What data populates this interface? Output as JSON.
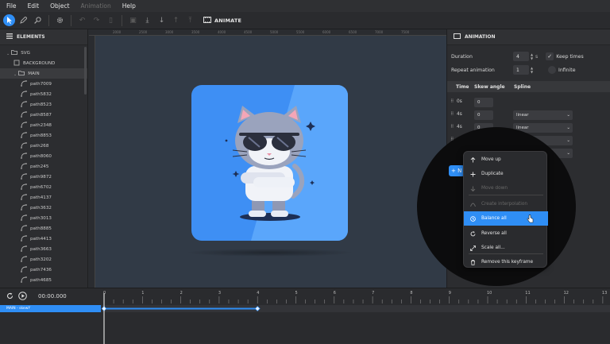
{
  "menu": {
    "items": [
      {
        "label": "File",
        "disabled": false
      },
      {
        "label": "Edit",
        "disabled": false
      },
      {
        "label": "Object",
        "disabled": false
      },
      {
        "label": "Animation",
        "disabled": true
      },
      {
        "label": "Help",
        "disabled": false
      }
    ]
  },
  "toolbar": {
    "animate_label": "ANIMATE"
  },
  "elements": {
    "title": "ELEMENTS",
    "tree": [
      {
        "label": "SVG",
        "level": 0,
        "kind": "folder"
      },
      {
        "label": "BACKGROUND",
        "level": 1,
        "kind": "item"
      },
      {
        "label": "MAIN",
        "level": 1,
        "kind": "folder",
        "selected": true
      },
      {
        "label": "path7009",
        "level": 2,
        "kind": "path"
      },
      {
        "label": "path5832",
        "level": 2,
        "kind": "path"
      },
      {
        "label": "path8523",
        "level": 2,
        "kind": "path"
      },
      {
        "label": "path8587",
        "level": 2,
        "kind": "path"
      },
      {
        "label": "path2348",
        "level": 2,
        "kind": "path"
      },
      {
        "label": "path8853",
        "level": 2,
        "kind": "path"
      },
      {
        "label": "path268",
        "level": 2,
        "kind": "path"
      },
      {
        "label": "path8060",
        "level": 2,
        "kind": "path"
      },
      {
        "label": "path245",
        "level": 2,
        "kind": "path"
      },
      {
        "label": "path9872",
        "level": 2,
        "kind": "path"
      },
      {
        "label": "path6702",
        "level": 2,
        "kind": "path"
      },
      {
        "label": "path4137",
        "level": 2,
        "kind": "path"
      },
      {
        "label": "path3632",
        "level": 2,
        "kind": "path"
      },
      {
        "label": "path3013",
        "level": 2,
        "kind": "path"
      },
      {
        "label": "path8885",
        "level": 2,
        "kind": "path"
      },
      {
        "label": "path4413",
        "level": 2,
        "kind": "path"
      },
      {
        "label": "path3663",
        "level": 2,
        "kind": "path"
      },
      {
        "label": "path3202",
        "level": 2,
        "kind": "path"
      },
      {
        "label": "path7436",
        "level": 2,
        "kind": "path"
      },
      {
        "label": "path4685",
        "level": 2,
        "kind": "path"
      }
    ]
  },
  "ruler": {
    "labels": [
      "2000",
      "2500",
      "3000",
      "3500",
      "4000",
      "4500",
      "5000",
      "5500",
      "6000",
      "6500",
      "7000",
      "7500"
    ]
  },
  "animation": {
    "title": "ANIMATION",
    "duration_label": "Duration",
    "duration_value": "4",
    "duration_unit": "s",
    "keep_times_label": "Keep times",
    "repeat_label": "Repeat animation",
    "repeat_value": "1",
    "infinite_label": "Infinite",
    "col_time": "Time",
    "col_skew": "Skew angle",
    "col_spline": "Spline",
    "keyframes": [
      {
        "time": "0s",
        "skew": "0",
        "spline": ""
      },
      {
        "time": "4s",
        "skew": "0",
        "spline": "linear"
      },
      {
        "time": "4s",
        "skew": "0",
        "spline": "linear"
      },
      {
        "time": "4s",
        "skew": "0",
        "spline": "linear"
      },
      {
        "time": "4s",
        "skew": "0",
        "spline": "linear"
      }
    ],
    "add_label": "+ N"
  },
  "context_menu": {
    "items": [
      {
        "label": "Move up",
        "icon": "arrow-up-icon",
        "disabled": false
      },
      {
        "label": "Duplicate",
        "icon": "plus-icon",
        "disabled": false
      },
      {
        "label": "Move down",
        "icon": "arrow-down-icon",
        "disabled": true
      },
      {
        "label": "Create interpolation",
        "icon": "interpolation-icon",
        "disabled": true
      },
      {
        "label": "Balance all",
        "icon": "clock-icon",
        "disabled": false,
        "highlighted": true
      },
      {
        "label": "Reverse all",
        "icon": "reverse-icon",
        "disabled": false
      },
      {
        "label": "Scale all...",
        "icon": "scale-icon",
        "disabled": false
      },
      {
        "label": "Remove this keyframe",
        "icon": "trash-icon",
        "disabled": false
      }
    ]
  },
  "timeline": {
    "time": "00:00.000",
    "track_label": "MAIN - skewY",
    "ticks": [
      "0",
      "1",
      "2",
      "3",
      "4",
      "5",
      "6",
      "7",
      "8",
      "9",
      "10",
      "11",
      "12",
      "13"
    ],
    "keyframe_seconds": [
      0,
      4
    ]
  },
  "colors": {
    "accent": "#2f8ef5",
    "artboard": "#3e8ff4"
  }
}
